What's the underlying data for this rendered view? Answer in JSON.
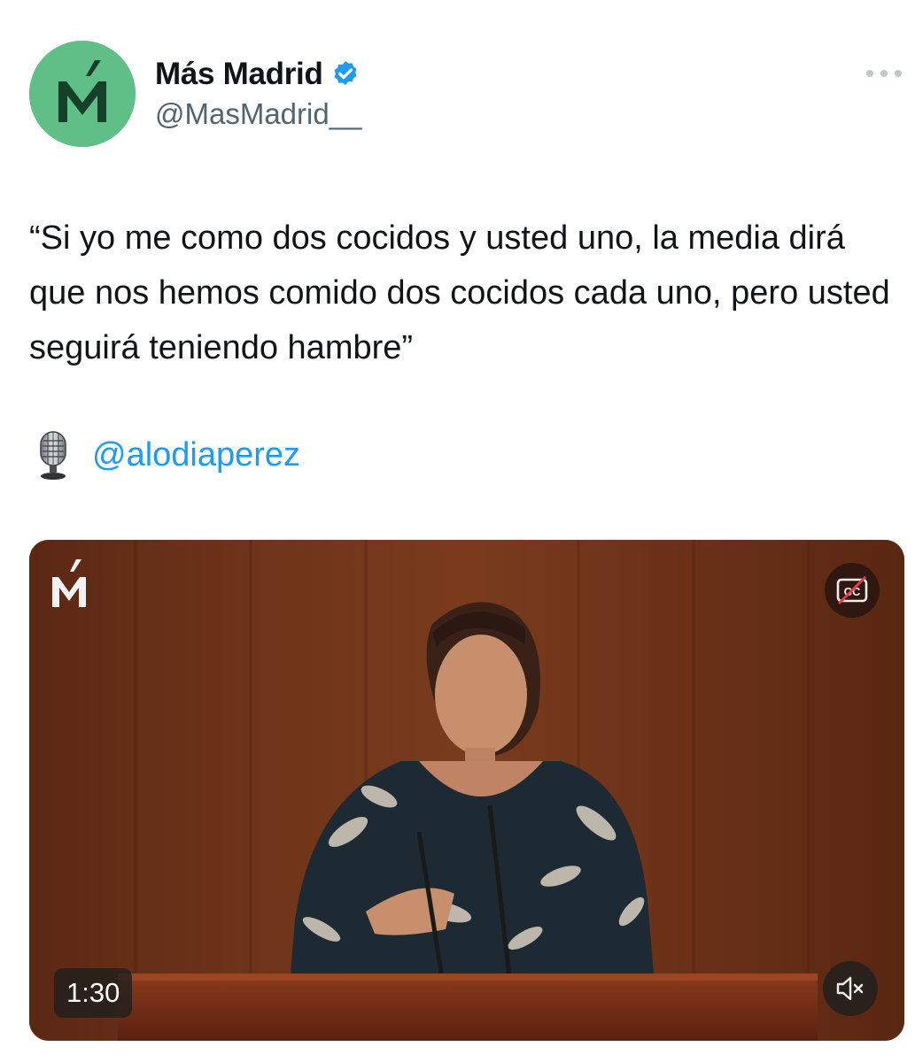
{
  "author": {
    "display_name": "Más Madrid",
    "handle": "@MasMadrid__",
    "avatar_icon": "mas-madrid-logo",
    "avatar_color": "#5fbf87",
    "verified": true
  },
  "tweet": {
    "text": "“Si yo me como dos cocidos y usted uno, la media dirá que nos hemos comido dos cocidos cada uno, pero usted seguirá teniendo hambre”",
    "credit_icon": "microphone-icon",
    "credit_mention": "@alodiaperez"
  },
  "video": {
    "duration": "1:30",
    "watermark_icon": "mas-madrid-watermark",
    "captions_icon": "closed-captions-icon",
    "mute_icon": "speaker-muted-icon"
  },
  "colors": {
    "link": "#1d9bf0",
    "verified": "#1d9bf0",
    "handle": "#536471",
    "text": "#0f1419"
  }
}
